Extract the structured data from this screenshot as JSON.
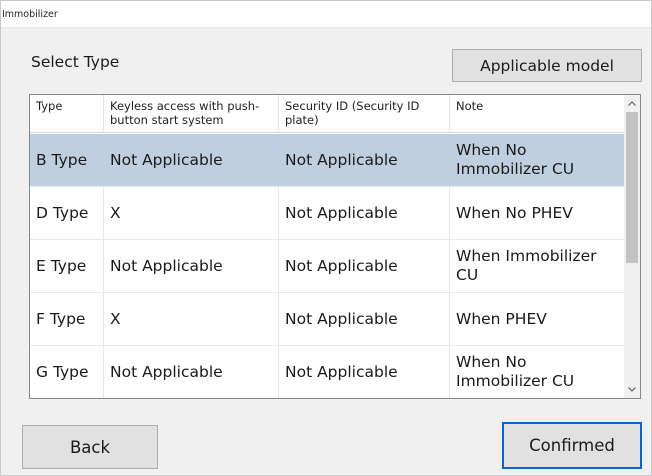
{
  "window": {
    "title": "Immobilizer"
  },
  "header": {
    "select_type_label": "Select Type",
    "applicable_model_button": "Applicable model"
  },
  "table": {
    "columns": [
      "Type",
      "Keyless access with push-button start system",
      "Security ID (Security ID plate)",
      "Note"
    ],
    "rows": [
      {
        "type": "B Type",
        "keyless": "Not Applicable",
        "security_id": "Not Applicable",
        "note": "When No Immobilizer CU",
        "selected": true
      },
      {
        "type": "D Type",
        "keyless": "X",
        "security_id": "Not Applicable",
        "note": "When No PHEV",
        "selected": false
      },
      {
        "type": "E Type",
        "keyless": "Not Applicable",
        "security_id": "Not Applicable",
        "note": "When Immobilizer CU",
        "selected": false
      },
      {
        "type": "F Type",
        "keyless": "X",
        "security_id": "Not Applicable",
        "note": "When PHEV",
        "selected": false
      },
      {
        "type": "G Type",
        "keyless": "Not Applicable",
        "security_id": "Not Applicable",
        "note": "When No Immobilizer  CU",
        "selected": false
      }
    ],
    "scroll_up_icon": "chevron-up-icon",
    "scroll_down_icon": "chevron-down-icon"
  },
  "footer": {
    "back_button": "Back",
    "confirmed_button": "Confirmed"
  },
  "colors": {
    "selected_row": "#c0cfe0",
    "focus_border": "#0b63d1",
    "button_bg": "#e1e1e1"
  }
}
